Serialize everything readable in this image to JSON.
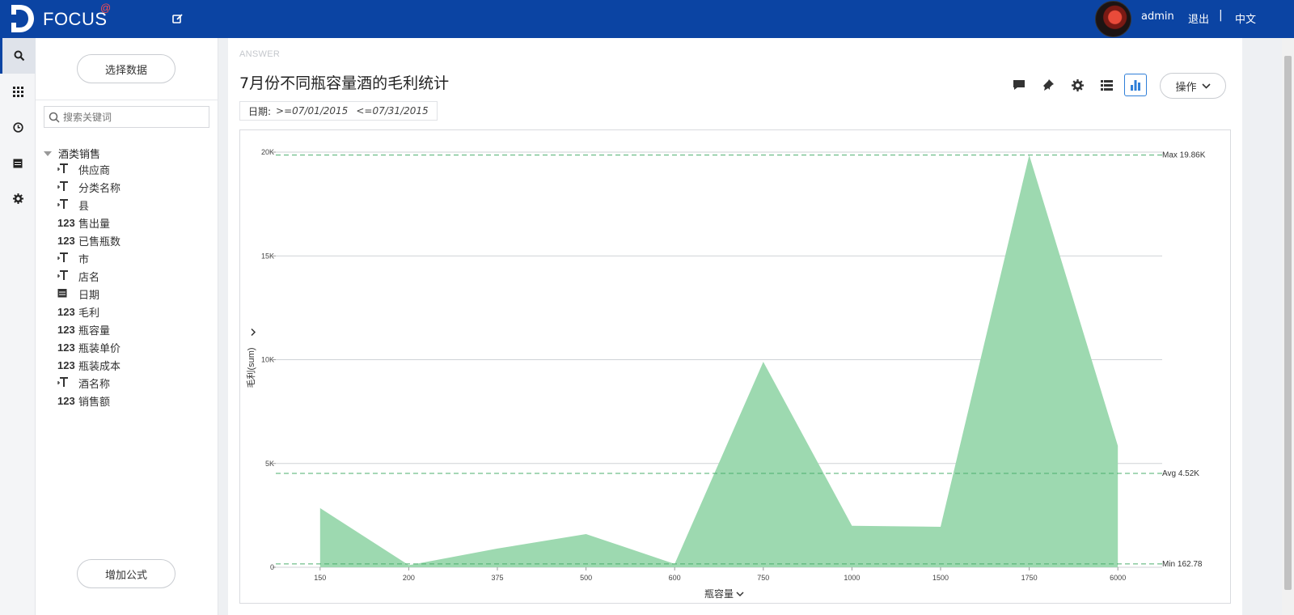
{
  "topbar": {
    "brand": "FOCUS",
    "brand_sup": "@",
    "user": "admin",
    "logout": "退出",
    "separator": "|",
    "language": "中文"
  },
  "rail": {
    "items": [
      "search-icon",
      "grid-icon",
      "clock-icon",
      "calendar-icon",
      "gear-icon"
    ]
  },
  "panel": {
    "select_data_label": "选择数据",
    "search_placeholder": "搜索关键词",
    "table_name": "酒类销售",
    "fields": [
      {
        "type": "T",
        "name": "供应商"
      },
      {
        "type": "T",
        "name": "分类名称"
      },
      {
        "type": "T",
        "name": "县"
      },
      {
        "type": "123",
        "name": "售出量"
      },
      {
        "type": "123",
        "name": "已售瓶数"
      },
      {
        "type": "T",
        "name": "市"
      },
      {
        "type": "T",
        "name": "店名"
      },
      {
        "type": "date",
        "name": "日期"
      },
      {
        "type": "123",
        "name": "毛利"
      },
      {
        "type": "123",
        "name": "瓶容量"
      },
      {
        "type": "123",
        "name": "瓶装单价"
      },
      {
        "type": "123",
        "name": "瓶装成本"
      },
      {
        "type": "T",
        "name": "酒名称"
      },
      {
        "type": "123",
        "name": "销售额"
      }
    ],
    "add_formula_label": "增加公式"
  },
  "main": {
    "answer_label": "ANSWER",
    "title": "7月份不同瓶容量酒的毛利统计",
    "filter": {
      "label": "日期:",
      "from": ">=07/01/2015",
      "to": "<=07/31/2015"
    },
    "toolbar": [
      "comment-icon",
      "pin-icon",
      "gear-icon",
      "list-icon",
      "bar-chart-icon"
    ],
    "operate_label": "操作"
  },
  "colors": {
    "topbar": "#0b44a3",
    "area_fill": "#9dd9b0",
    "reference_line": "#4caf6e",
    "active_tool": "#2f7fd8"
  },
  "chart_data": {
    "type": "area",
    "categories": [
      "150",
      "200",
      "375",
      "500",
      "600",
      "750",
      "1000",
      "1500",
      "1750",
      "6000"
    ],
    "values": [
      2850,
      100,
      900,
      1600,
      162.78,
      9900,
      2000,
      1950,
      19860,
      5850
    ],
    "xlabel": "瓶容量",
    "ylabel": "毛利(sum)",
    "ylim": [
      0,
      20000
    ],
    "yticks": [
      {
        "v": 0,
        "label": "0"
      },
      {
        "v": 5000,
        "label": "5K"
      },
      {
        "v": 10000,
        "label": "10K"
      },
      {
        "v": 15000,
        "label": "15K"
      },
      {
        "v": 20000,
        "label": "20K"
      }
    ],
    "reference_lines": [
      {
        "label": "Max 19.86K",
        "value": 19860
      },
      {
        "label": "Avg 4.52K",
        "value": 4520
      },
      {
        "label": "Min 162.78",
        "value": 162.78
      }
    ],
    "grid": true
  }
}
